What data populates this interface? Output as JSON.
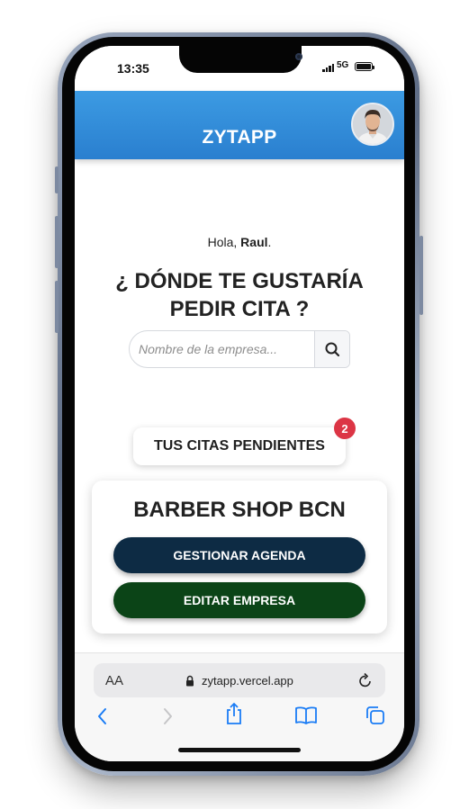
{
  "status_bar": {
    "time": "13:35",
    "network": "5G"
  },
  "header": {
    "title": "ZYTAPP",
    "avatar_icon": "user-avatar-photo"
  },
  "greeting": {
    "prefix": "Hola, ",
    "name": "Raul",
    "suffix": "."
  },
  "question": {
    "line1": "¿ DÓNDE TE GUSTARÍA",
    "line2": "PEDIR CITA ?"
  },
  "search": {
    "placeholder": "Nombre de la empresa...",
    "icon": "search-icon"
  },
  "pending": {
    "label": "TUS CITAS PENDIENTES",
    "count": "2"
  },
  "business_card": {
    "name": "BARBER SHOP BCN",
    "manage_label": "GESTIONAR AGENDA",
    "edit_label": "EDITAR EMPRESA"
  },
  "browser": {
    "aa_label": "AA",
    "url": "zytapp.vercel.app",
    "nav_icons": [
      "back-icon",
      "forward-icon",
      "share-icon",
      "bookmarks-icon",
      "tabs-icon"
    ]
  },
  "colors": {
    "header_blue": "#3c9be3",
    "agenda_button": "#0d2b44",
    "empresa_button": "#0b4417",
    "badge_red": "#dc3545",
    "safari_blue": "#1a7cf5"
  }
}
